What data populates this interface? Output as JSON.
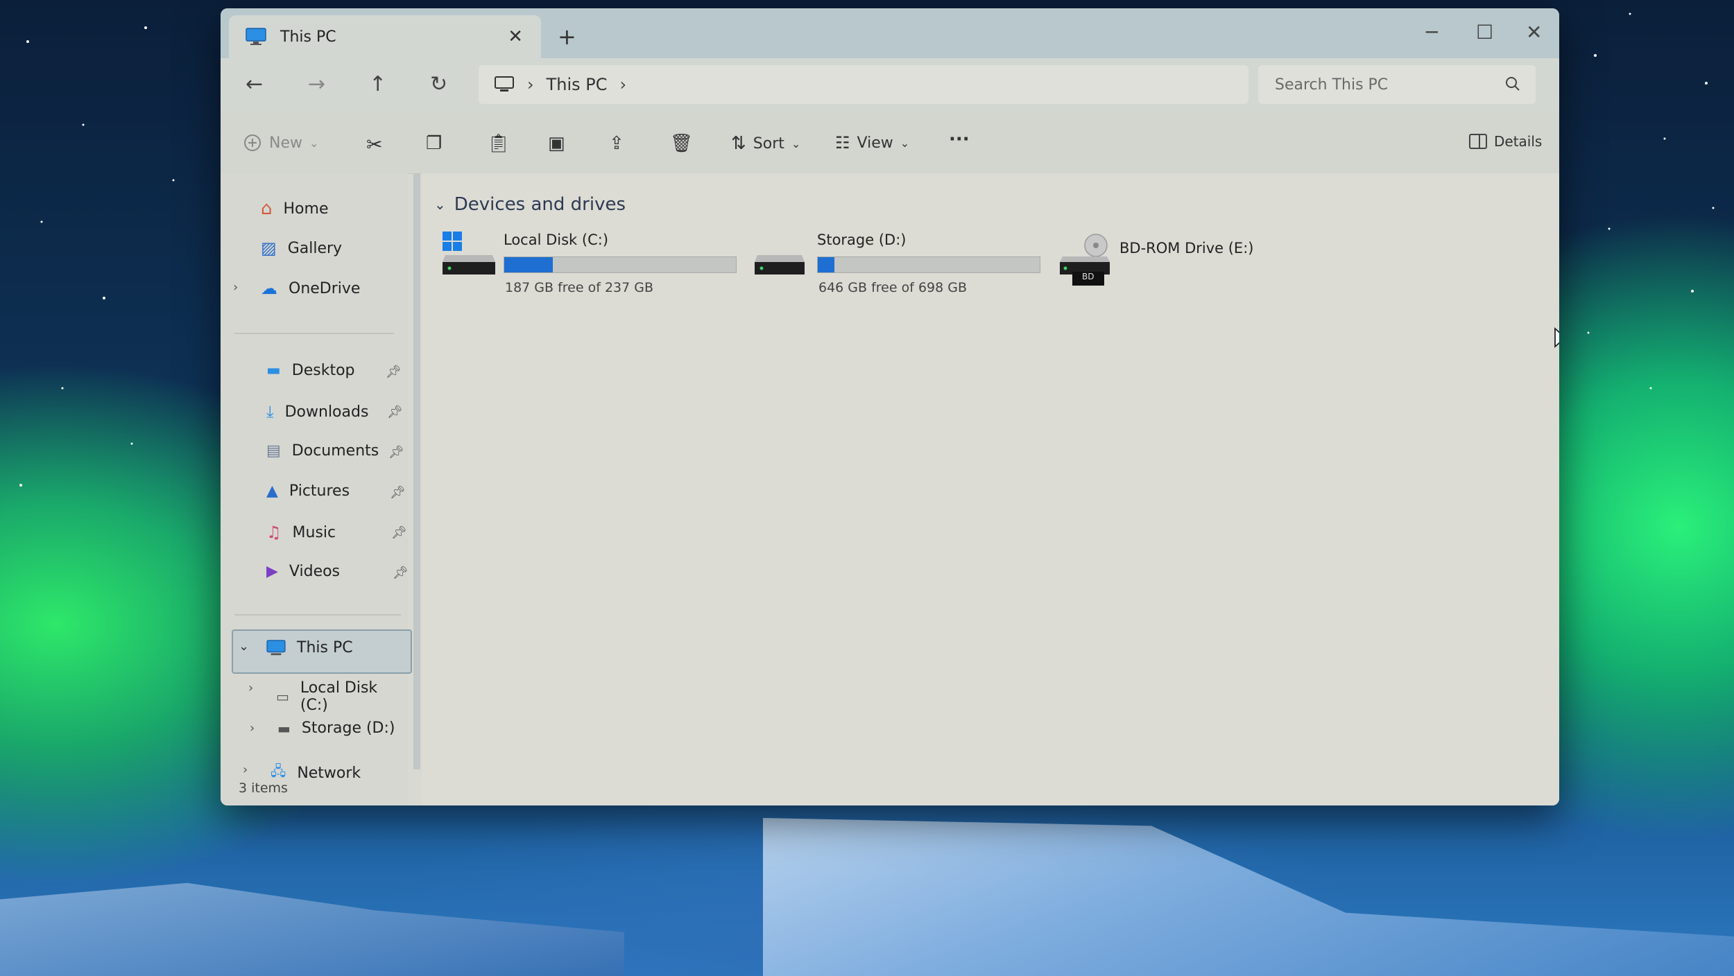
{
  "window": {
    "tab_title": "This PC",
    "new_tab_glyph": "+",
    "close_glyph": "✕",
    "minimize_glyph": "─",
    "maximize_glyph": "☐"
  },
  "nav": {
    "breadcrumb": [
      "This PC"
    ],
    "search_placeholder": "Search This PC"
  },
  "toolbar": {
    "new_label": "New",
    "sort_label": "Sort",
    "view_label": "View",
    "more_label": "···",
    "details_label": "Details"
  },
  "sidebar": {
    "top": [
      {
        "label": "Home",
        "icon": "home-icon"
      },
      {
        "label": "Gallery",
        "icon": "gallery-icon"
      },
      {
        "label": "OneDrive",
        "icon": "cloud-icon"
      }
    ],
    "pinned": [
      {
        "label": "Desktop",
        "icon": "desktop-icon"
      },
      {
        "label": "Downloads",
        "icon": "download-icon"
      },
      {
        "label": "Documents",
        "icon": "documents-icon"
      },
      {
        "label": "Pictures",
        "icon": "pictures-icon"
      },
      {
        "label": "Music",
        "icon": "music-icon"
      },
      {
        "label": "Videos",
        "icon": "videos-icon"
      }
    ],
    "this_pc": "This PC",
    "drives": [
      "Local Disk (C:)",
      "Storage (D:)"
    ],
    "network": "Network"
  },
  "main": {
    "group_title": "Devices and drives",
    "drives": [
      {
        "name": "Local Disk (C:)",
        "free_text": "187 GB free of 237 GB",
        "used_fraction": 0.21
      },
      {
        "name": "Storage (D:)",
        "free_text": "646 GB free of 698 GB",
        "used_fraction": 0.075
      },
      {
        "name": "BD-ROM Drive (E:)",
        "badge": "BD"
      }
    ]
  },
  "status": {
    "items": "3 items"
  },
  "colors": {
    "accent": "#1e6fd1",
    "window_bg": "#d8d9d3",
    "titlebar": "#b9c8cc"
  }
}
